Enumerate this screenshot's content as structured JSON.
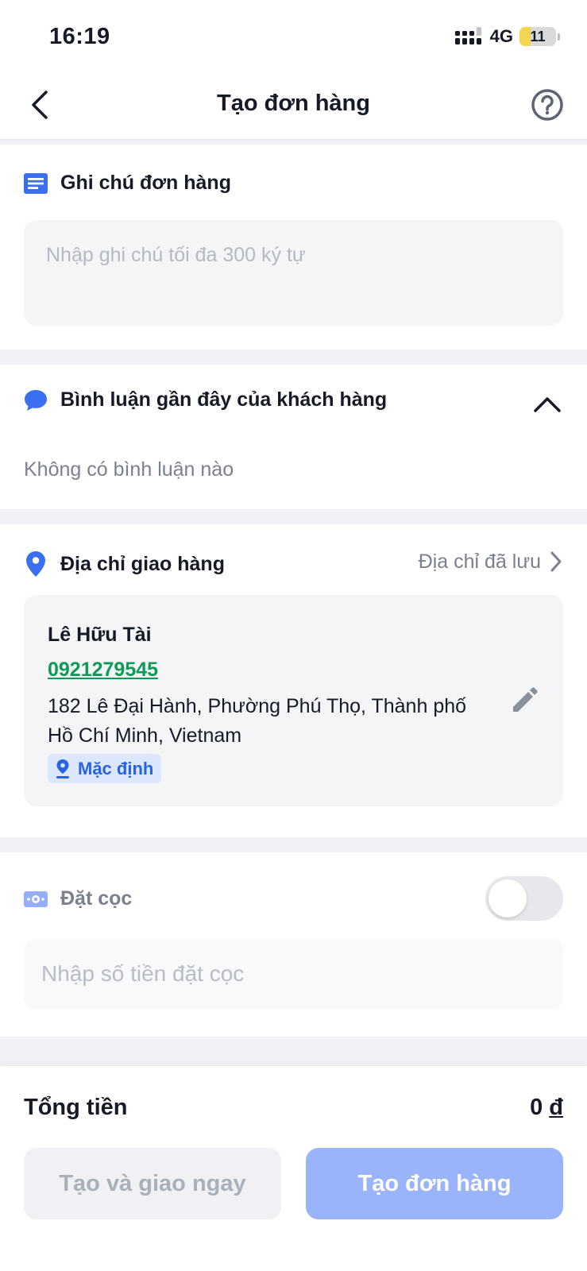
{
  "status_bar": {
    "time": "16:19",
    "network": "4G",
    "battery": "11"
  },
  "header": {
    "title": "Tạo đơn hàng",
    "back_icon": "chevron-left-icon",
    "help_icon": "question-circle-icon"
  },
  "order_note": {
    "title": "Ghi chú đơn hàng",
    "placeholder": "Nhập ghi chú tối đa 300 ký tự",
    "value": ""
  },
  "comments": {
    "title": "Bình luận gần đây của khách hàng",
    "empty_text": "Không có bình luận nào"
  },
  "shipping_address": {
    "title": "Địa chỉ giao hàng",
    "saved_link": "Địa chỉ đã lưu",
    "name": "Lê Hữu Tài",
    "phone": "0921279545",
    "address": "182 Lê Đại Hành, Phường Phú Thọ, Thành phố Hồ Chí Minh, Vietnam",
    "badge": "Mặc định"
  },
  "deposit": {
    "title": "Đặt cọc",
    "enabled": false,
    "placeholder": "Nhập số tiền đặt cọc",
    "value": ""
  },
  "footer": {
    "total_label": "Tổng tiền",
    "total_amount": "0",
    "currency": "đ",
    "secondary_button": "Tạo và giao ngay",
    "primary_button": "Tạo đơn hàng"
  },
  "colors": {
    "accent": "#2a63e0",
    "phone": "#0f9a58",
    "primary_button": "#9ab4fb"
  }
}
